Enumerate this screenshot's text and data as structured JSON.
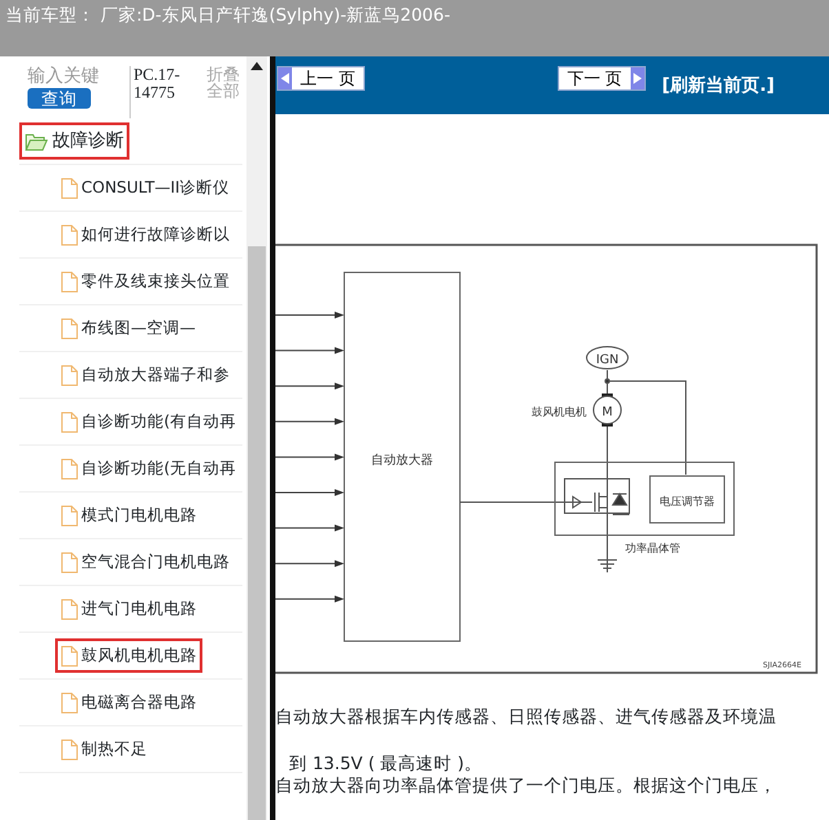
{
  "window": {
    "title": "当前车型：  厂家:D-东风日产轩逸(Sylphy)-新蓝鸟2006-"
  },
  "sidebar": {
    "search": {
      "placeholder": "输入关键"
    },
    "search_button": "查询",
    "code": "PC.17-14775",
    "collapse_all": "折叠全部",
    "tree": [
      {
        "label": "故障诊断",
        "expanded": true,
        "highlighted": true,
        "children": [
          {
            "label": "CONSULT—II诊断仪",
            "highlighted": false
          },
          {
            "label": "如何进行故障诊断以",
            "highlighted": false
          },
          {
            "label": "零件及线束接头位置",
            "highlighted": false
          },
          {
            "label": "布线图—空调—",
            "highlighted": false
          },
          {
            "label": "自动放大器端子和参",
            "highlighted": false
          },
          {
            "label": "自诊断功能(有自动再",
            "highlighted": false
          },
          {
            "label": "自诊断功能(无自动再",
            "highlighted": false
          },
          {
            "label": "模式门电机电路",
            "highlighted": false
          },
          {
            "label": "空气混合门电机电路",
            "highlighted": false
          },
          {
            "label": "进气门电机电路",
            "highlighted": false
          },
          {
            "label": "鼓风机电机电路",
            "highlighted": true
          },
          {
            "label": "电磁离合器电路",
            "highlighted": false
          },
          {
            "label": "制热不足",
            "highlighted": false
          }
        ]
      }
    ]
  },
  "toolbar": {
    "prev": "上一 页",
    "next": "下一 页",
    "refresh": "[刷新当前页.]"
  },
  "diagram": {
    "amplifier": "自动放大器",
    "ign": "IGN",
    "motor_label": "鼓风机电机",
    "motor_symbol": "M",
    "regulator": "电压调节器",
    "transistor": "功率晶体管",
    "figure_id": "SJIA2664E"
  },
  "paragraphs": [
    "自动放大器根据车内传感器、日照传感器、进气传感器及环境温",
    "到 13.5V ( 最高速时 )。",
    "自动放大器向功率晶体管提供了一个门电压。根据这个门电压，"
  ]
}
